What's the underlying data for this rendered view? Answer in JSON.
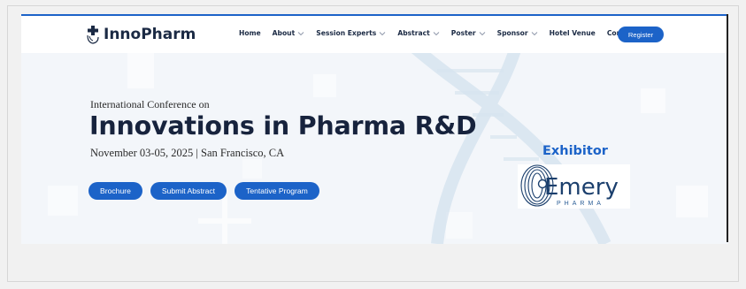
{
  "brand": {
    "name": "InnoPharm",
    "logo_icon": "pharma-cross-hand-icon"
  },
  "nav": {
    "items": [
      {
        "label": "Home",
        "dropdown": false
      },
      {
        "label": "About",
        "dropdown": true
      },
      {
        "label": "Session Experts",
        "dropdown": true
      },
      {
        "label": "Abstract",
        "dropdown": true
      },
      {
        "label": "Poster",
        "dropdown": true
      },
      {
        "label": "Sponsor",
        "dropdown": true
      },
      {
        "label": "Hotel Venue",
        "dropdown": false
      },
      {
        "label": "Contact",
        "dropdown": false
      }
    ],
    "register_label": "Register"
  },
  "hero": {
    "eyebrow": "International Conference on",
    "title": "Innovations in Pharma R&D",
    "date_location": "November 03-05, 2025 | San Francisco, CA",
    "buttons": [
      "Brochure",
      "Submit Abstract",
      "Tentative Program"
    ]
  },
  "exhibitor": {
    "label": "Exhibitor",
    "sponsor_name": "Emery",
    "sponsor_subtitle": "PHARMA"
  },
  "colors": {
    "accent": "#1c63c8",
    "heading": "#17233d",
    "nav_text": "#1b2a44"
  }
}
